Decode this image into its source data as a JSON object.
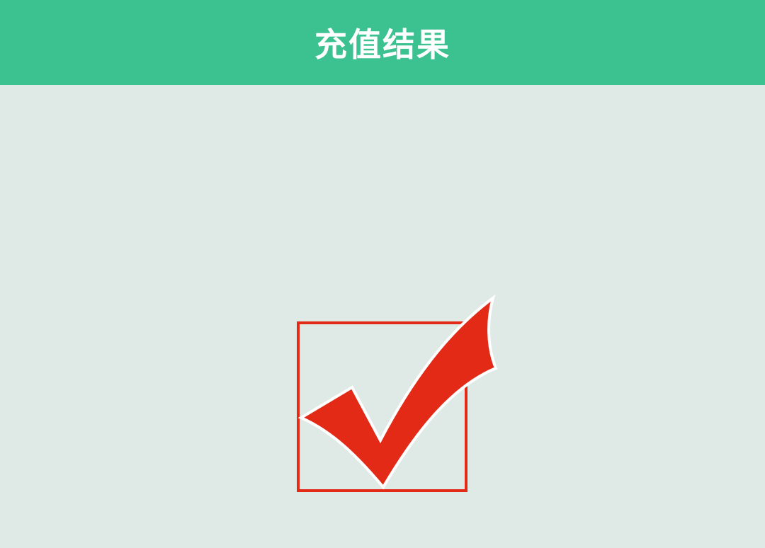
{
  "header": {
    "title": "充值结果"
  },
  "result": {
    "icon": "checkmark-in-box-icon"
  },
  "colors": {
    "header_bg": "#3cc190",
    "page_bg": "#dfe9e5",
    "check_red": "#e22a17",
    "title_text": "#ffffff"
  }
}
